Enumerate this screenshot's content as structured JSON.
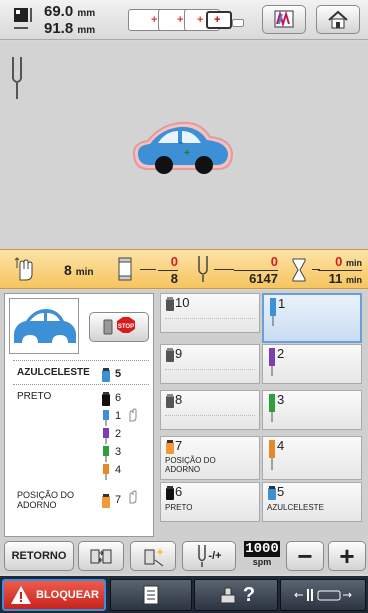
{
  "topbar": {
    "width_value": "69.0",
    "height_value": "91.8",
    "unit": "mm"
  },
  "timebar": {
    "remaining_time": "8",
    "remaining_unit": "min",
    "color_done": "0",
    "color_total": "8",
    "stitch_done": "0",
    "stitch_total": "6147",
    "elapsed_time": "0",
    "total_time": "11",
    "time_unit": "min"
  },
  "sequence": [
    {
      "label": "AZULCELESTE",
      "num": "5",
      "bold": true
    },
    {
      "label": "PRETO",
      "num": "6"
    },
    {
      "label": "",
      "num": "1"
    },
    {
      "label": "",
      "num": "2"
    },
    {
      "label": "",
      "num": "3"
    },
    {
      "label": "",
      "num": "4"
    },
    {
      "label": "POSIÇÃO DO\nADORNO",
      "num": "7"
    }
  ],
  "grid": [
    {
      "n": "10",
      "label": ""
    },
    {
      "n": "1",
      "label": ""
    },
    {
      "n": "9",
      "label": ""
    },
    {
      "n": "2",
      "label": ""
    },
    {
      "n": "8",
      "label": ""
    },
    {
      "n": "3",
      "label": ""
    },
    {
      "n": "7",
      "label": "POSIÇÃO DO\nADORNO"
    },
    {
      "n": "4",
      "label": ""
    },
    {
      "n": "6",
      "label": "PRETO"
    },
    {
      "n": "5",
      "label": "AZULCELESTE"
    }
  ],
  "controls": {
    "retorno": "RETORNO",
    "speed_value": "1000",
    "speed_unit": "spm",
    "speed_btn": "-/+"
  },
  "bottom": {
    "lock_label": "BLOQUEAR"
  },
  "colors": {
    "blue": "#3d8fd6",
    "red": "#e0383b",
    "orange": "#f6c55e",
    "selected": "#6aa0d8"
  }
}
